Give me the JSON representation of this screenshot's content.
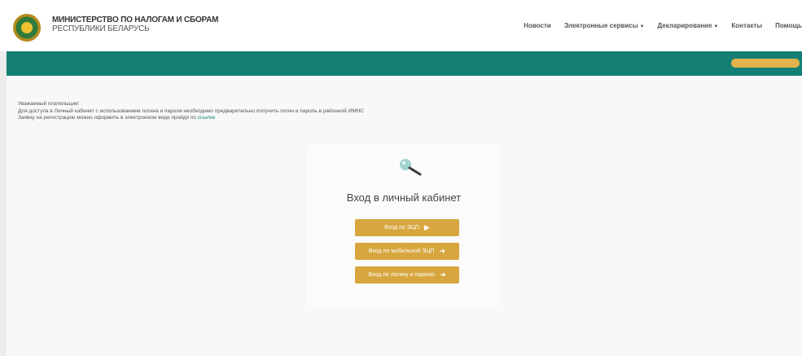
{
  "header": {
    "org_line1": "МИНИСТЕРСТВО ПО НАЛОГАМ И СБОРАМ",
    "org_line2": "РЕСПУБЛИКИ БЕЛАРУСЬ"
  },
  "nav": {
    "items": [
      "Новости",
      "Электронные сервисы",
      "Декларирование",
      "Контакты",
      "Помощь"
    ]
  },
  "notice": {
    "line1": "Уважаемый плательщик!",
    "line2": "Для доступа в Личный кабинет с использованием логина и пароля необходимо предварительно получить логин и пароль в районной ИМНС",
    "line3_prefix": "Заявку на регистрацию можно оформить в электронном виде пройдя по",
    "line3_link": "ссылке"
  },
  "login": {
    "title": "Вход в личный кабинет",
    "btn_ecp": "Вход по ЭЦП",
    "btn_mobile": "Вход по мобильной ЭЦП",
    "btn_password": "Вход по логину и паролю"
  },
  "colors": {
    "teal": "#147f74",
    "gold": "#d7a63e"
  }
}
